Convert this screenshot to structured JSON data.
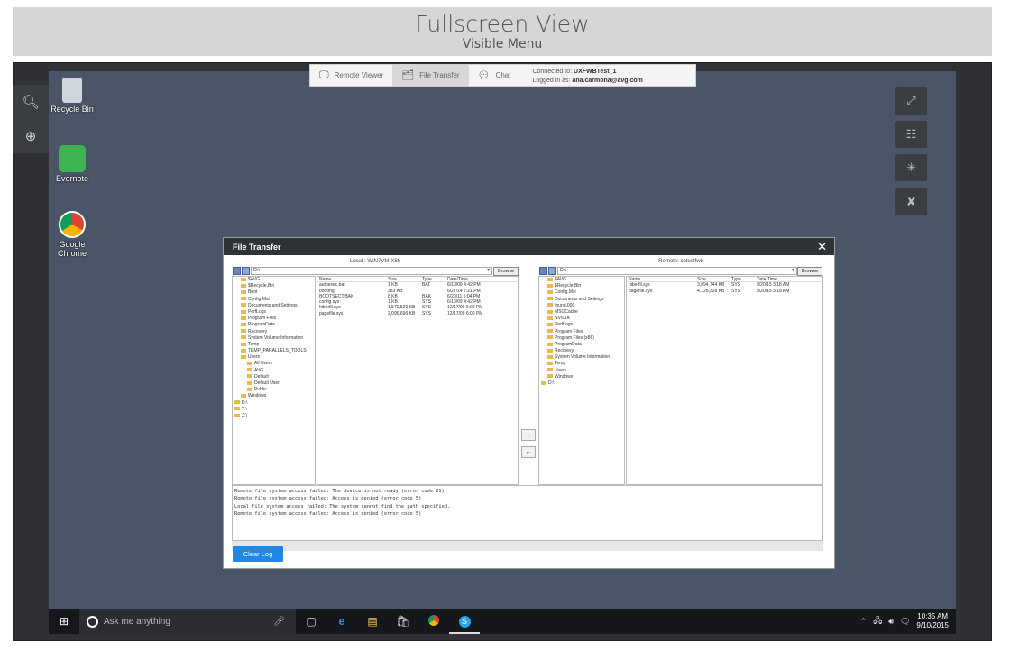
{
  "header": {
    "title": "Fullscreen View",
    "subtitle": "Visible Menu"
  },
  "toolbar": {
    "tabs": [
      {
        "label": "Remote Viewer",
        "icon": "monitor-icon"
      },
      {
        "label": "File Transfer",
        "icon": "file-transfer-icon"
      },
      {
        "label": "Chat",
        "icon": "chat-icon"
      }
    ],
    "connected_label": "Connected to:",
    "connected_value": "UXFWBTest_1",
    "logged_label": "Logged in as:",
    "logged_value": "ana.carmona@avg.com"
  },
  "desktop_icons": [
    {
      "label": "Recycle Bin",
      "icon": "recycle-bin-icon"
    },
    {
      "label": "Evernote",
      "icon": "evernote-icon"
    },
    {
      "label": "Google Chrome",
      "icon": "chrome-icon"
    }
  ],
  "file_transfer": {
    "title": "File Transfer",
    "local": {
      "title": "Local : WIN7VM-X86",
      "path": "D:\\",
      "browse": "Browse",
      "tree": [
        {
          "label": "$AVG",
          "depth": 1
        },
        {
          "label": "$Recycle.Bin",
          "depth": 1
        },
        {
          "label": "Boot",
          "depth": 1
        },
        {
          "label": "Config.Msi",
          "depth": 1
        },
        {
          "label": "Documents and Settings",
          "depth": 1
        },
        {
          "label": "PerfLogs",
          "depth": 1
        },
        {
          "label": "Program Files",
          "depth": 1
        },
        {
          "label": "ProgramData",
          "depth": 1
        },
        {
          "label": "Recovery",
          "depth": 1
        },
        {
          "label": "System Volume Information",
          "depth": 1
        },
        {
          "label": "Temp",
          "depth": 1
        },
        {
          "label": "TEMP_PARALLELS_TOOLS",
          "depth": 1
        },
        {
          "label": "Users",
          "depth": 1
        },
        {
          "label": "All Users",
          "depth": 2
        },
        {
          "label": "AVG",
          "depth": 2
        },
        {
          "label": "Default",
          "depth": 2
        },
        {
          "label": "Default User",
          "depth": 2
        },
        {
          "label": "Public",
          "depth": 2
        },
        {
          "label": "Windows",
          "depth": 1
        },
        {
          "label": "D:\\",
          "depth": 0
        },
        {
          "label": "Y:\\",
          "depth": 0
        },
        {
          "label": "Z:\\",
          "depth": 0
        }
      ],
      "columns": [
        "Name",
        "Size",
        "Type",
        "Date/Time"
      ],
      "files": [
        [
          "autoexec.bat",
          "1 KB",
          "BAT",
          "6/10/09 4:42 PM"
        ],
        [
          "bootmgr",
          "383 KB",
          "",
          "6/27/14 7:21 PM"
        ],
        [
          "BOOTSECT.BAK",
          "8 KB",
          "BAK",
          "6/20/11 5:04 PM"
        ],
        [
          "config.sys",
          "1 KB",
          "SYS",
          "6/10/09 4:42 PM"
        ],
        [
          "hiberfil.sys",
          "1,572,520 KB",
          "SYS",
          "12/17/09 6:00 PM"
        ],
        [
          "pagefile.sys",
          "2,096,696 KB",
          "SYS",
          "12/17/09 6:00 PM"
        ]
      ]
    },
    "remote": {
      "title": "Remote: cotestfwb",
      "path": "D:\\",
      "browse": "Browse",
      "tree": [
        {
          "label": "$AVG",
          "depth": 1
        },
        {
          "label": "$Recycle.Bin",
          "depth": 1
        },
        {
          "label": "Config.Msi",
          "depth": 1
        },
        {
          "label": "Documents and Settings",
          "depth": 1
        },
        {
          "label": "found.000",
          "depth": 1
        },
        {
          "label": "MSOCache",
          "depth": 1
        },
        {
          "label": "NVIDIA",
          "depth": 1
        },
        {
          "label": "PerfLogs",
          "depth": 1
        },
        {
          "label": "Program Files",
          "depth": 1
        },
        {
          "label": "Program Files (x86)",
          "depth": 1
        },
        {
          "label": "ProgramData",
          "depth": 1
        },
        {
          "label": "Recovery",
          "depth": 1
        },
        {
          "label": "System Volume Information",
          "depth": 1
        },
        {
          "label": "Temp",
          "depth": 1
        },
        {
          "label": "Users",
          "depth": 1
        },
        {
          "label": "Windows",
          "depth": 1
        },
        {
          "label": "D:\\",
          "depth": 0
        }
      ],
      "columns": [
        "Name",
        "Size",
        "Type",
        "Date/Time"
      ],
      "files": [
        [
          "hiberfil.sys",
          "3,094,744 KB",
          "SYS",
          "8/20/15 3:18 AM"
        ],
        [
          "pagefile.sys",
          "4,126,328 KB",
          "SYS",
          "8/20/15 3:18 AM"
        ]
      ]
    },
    "log": [
      "Remote file system access failed: The device is not ready (error code 21)",
      "Remote file system access failed: Access is denied (error code 5)",
      "Local file system access failed: The system cannot find the path specified.",
      "Remote file system access failed: Access is denied (error code 5)"
    ],
    "clear_log": "Clear Log"
  },
  "taskbar": {
    "search_placeholder": "Ask me anything",
    "time": "10:35 AM",
    "date": "9/10/2015"
  }
}
